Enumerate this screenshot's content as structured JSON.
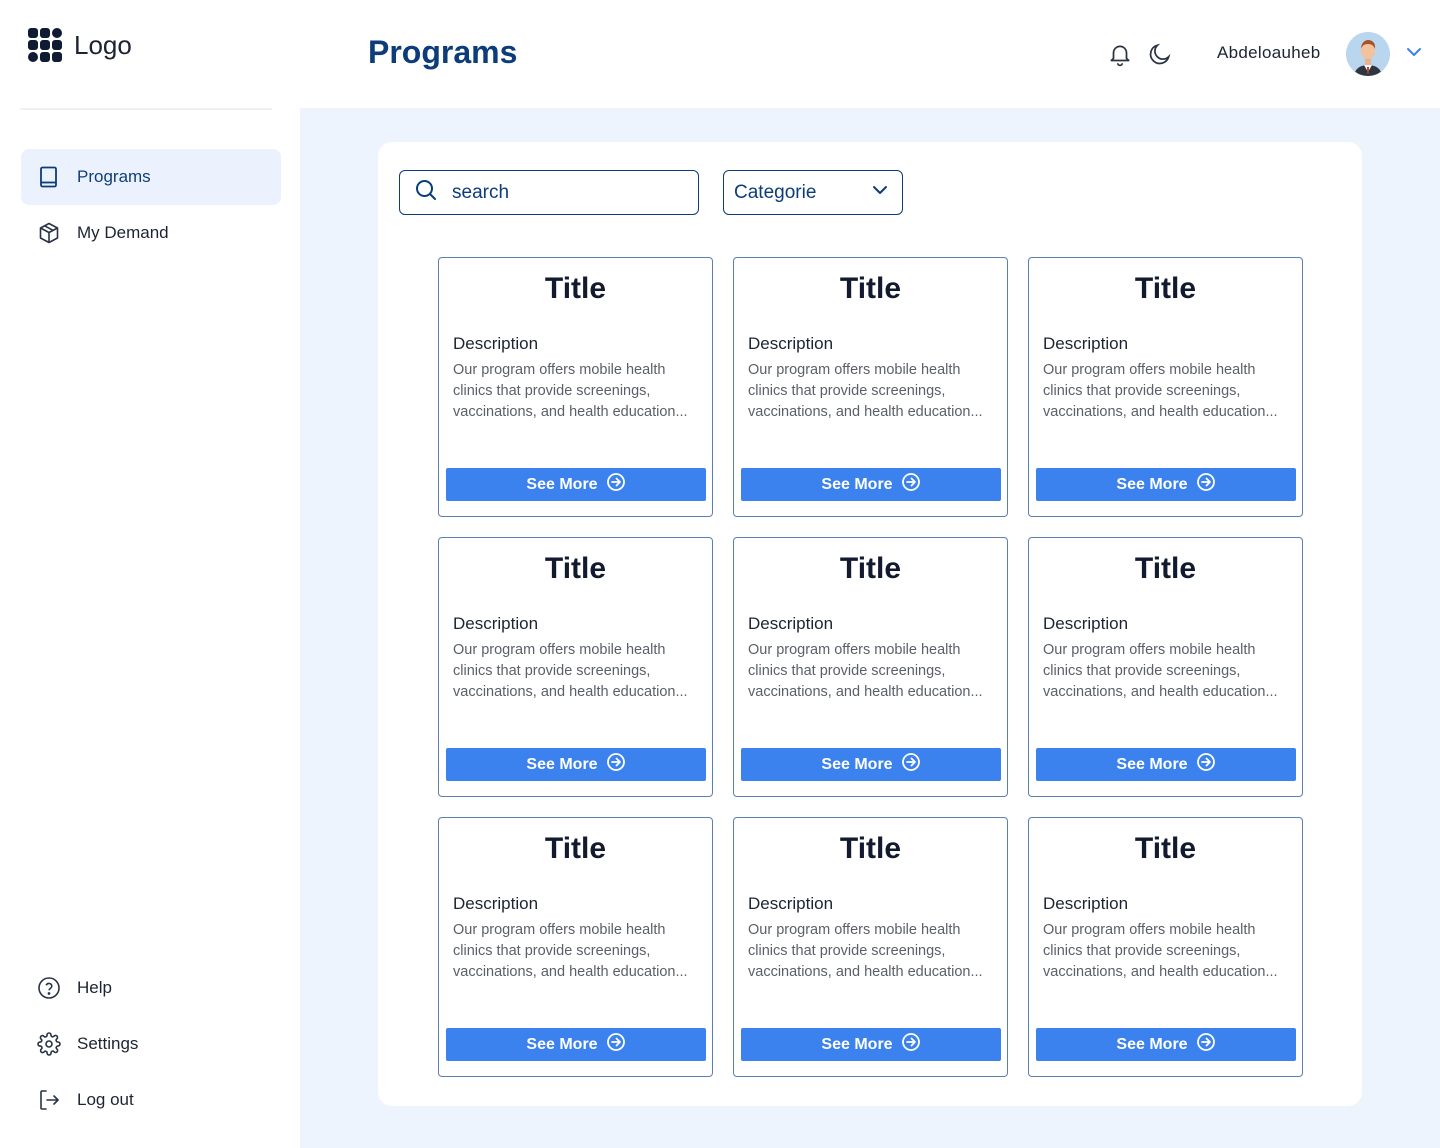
{
  "sidebar": {
    "logo_text": "Logo",
    "nav": [
      {
        "label": "Programs",
        "icon": "book-icon",
        "active": true
      },
      {
        "label": "My Demand",
        "icon": "package-icon",
        "active": false
      }
    ],
    "bottom": [
      {
        "label": "Help",
        "icon": "help-circle-icon"
      },
      {
        "label": "Settings",
        "icon": "gear-icon"
      },
      {
        "label": "Log out",
        "icon": "logout-icon"
      }
    ]
  },
  "header": {
    "title": "Programs",
    "username": "Abdeloauheb"
  },
  "filters": {
    "search_placeholder": "search",
    "category_label": "Categorie"
  },
  "cards": [
    {
      "title": "Title",
      "desc_heading": "Description",
      "desc": "Our program offers mobile health clinics that provide screenings, vaccinations, and health education...",
      "button": "See More"
    },
    {
      "title": "Title",
      "desc_heading": "Description",
      "desc": "Our program offers mobile health clinics that provide screenings, vaccinations, and health education...",
      "button": "See More"
    },
    {
      "title": "Title",
      "desc_heading": "Description",
      "desc": "Our program offers mobile health clinics that provide screenings, vaccinations, and health education...",
      "button": "See More"
    },
    {
      "title": "Title",
      "desc_heading": "Description",
      "desc": "Our program offers mobile health clinics that provide screenings, vaccinations, and health education...",
      "button": "See More"
    },
    {
      "title": "Title",
      "desc_heading": "Description",
      "desc": "Our program offers mobile health clinics that provide screenings, vaccinations, and health education...",
      "button": "See More"
    },
    {
      "title": "Title",
      "desc_heading": "Description",
      "desc": "Our program offers mobile health clinics that provide screenings, vaccinations, and health education...",
      "button": "See More"
    },
    {
      "title": "Title",
      "desc_heading": "Description",
      "desc": "Our program offers mobile health clinics that provide screenings, vaccinations, and health education...",
      "button": "See More"
    },
    {
      "title": "Title",
      "desc_heading": "Description",
      "desc": "Our program offers mobile health clinics that provide screenings, vaccinations, and health education...",
      "button": "See More"
    },
    {
      "title": "Title",
      "desc_heading": "Description",
      "desc": "Our program offers mobile health clinics that provide screenings, vaccinations, and health education...",
      "button": "See More"
    }
  ],
  "colors": {
    "accent": "#3b82ef",
    "title": "#0c3d7a",
    "active_bg": "#ebf2fd",
    "page_bg": "#eef4fd"
  }
}
